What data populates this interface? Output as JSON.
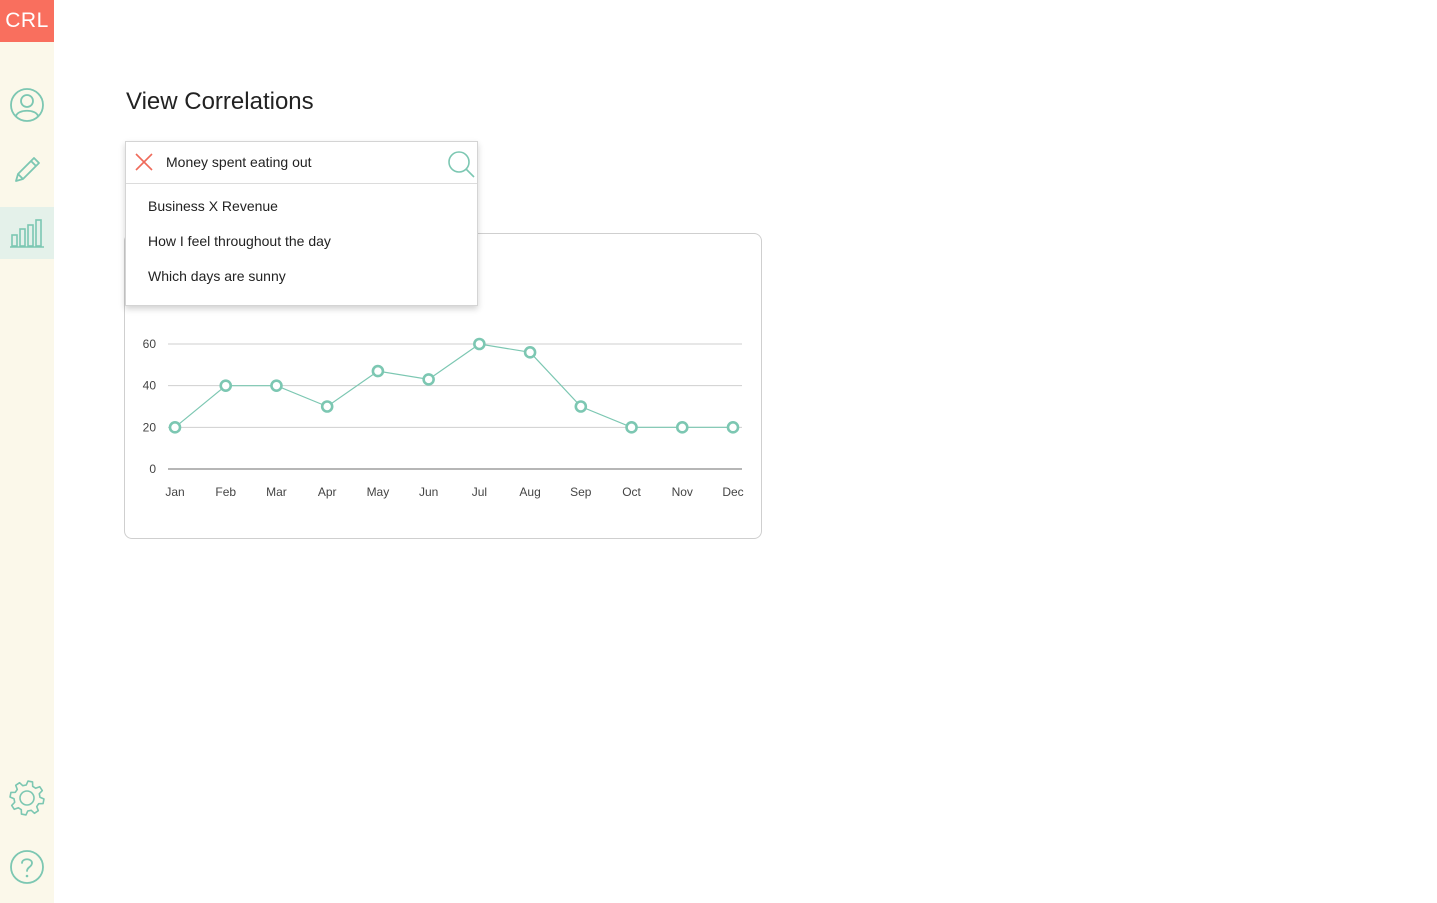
{
  "app": {
    "logo_text": "CRL"
  },
  "sidebar": {
    "items": [
      {
        "name": "profile",
        "icon": "user-icon"
      },
      {
        "name": "edit",
        "icon": "pencil-icon"
      },
      {
        "name": "correlations",
        "icon": "bar-chart-icon",
        "active": true
      },
      {
        "name": "settings",
        "icon": "gear-icon"
      },
      {
        "name": "help",
        "icon": "question-icon"
      }
    ]
  },
  "page": {
    "title": "View Correlations"
  },
  "search": {
    "value": "Money spent eating out",
    "clear_icon": "close-icon",
    "search_icon": "search-icon",
    "suggestions": [
      "Business X Revenue",
      "How I feel throughout the day",
      "Which days are sunny"
    ]
  },
  "colors": {
    "accent": "#7cc7b2",
    "logo_bg": "#f96f5e",
    "sidebar_bg": "#fbf8ea",
    "active_nav_bg": "#e4f1ea",
    "clear_icon": "#ef6a5a"
  },
  "chart_data": {
    "type": "line",
    "categories": [
      "Jan",
      "Feb",
      "Mar",
      "Apr",
      "May",
      "Jun",
      "Jul",
      "Aug",
      "Sep",
      "Oct",
      "Nov",
      "Dec"
    ],
    "series": [
      {
        "values": [
          20,
          40,
          40,
          30,
          47,
          43,
          60,
          56,
          30,
          20,
          20,
          20
        ]
      }
    ],
    "yticks": [
      0,
      20,
      40,
      60
    ],
    "ylim": [
      0,
      60
    ],
    "grid": true,
    "title": "",
    "xlabel": "",
    "ylabel": ""
  }
}
